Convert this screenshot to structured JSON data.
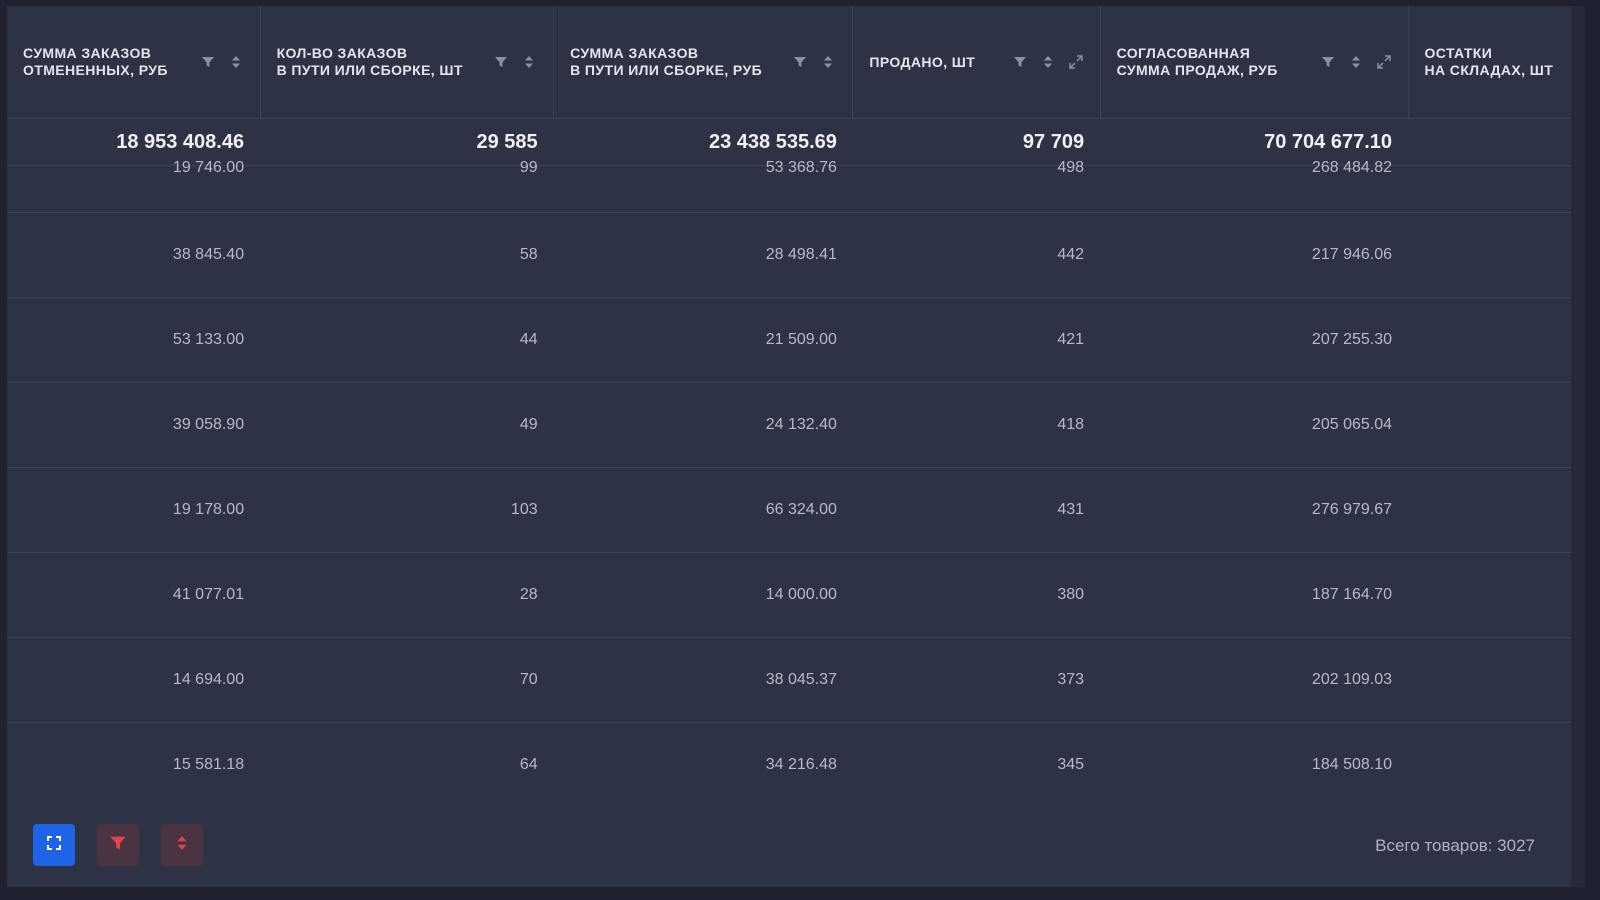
{
  "columns": [
    {
      "label": "СУММА ЗАКАЗОВ\nОТМЕНЕННЫХ, РУБ",
      "expand": false
    },
    {
      "label": "КОЛ-ВО ЗАКАЗОВ\nВ ПУТИ ИЛИ СБОРКЕ, ШТ",
      "expand": false
    },
    {
      "label": "СУММА ЗАКАЗОВ\nВ ПУТИ ИЛИ СБОРКЕ, РУБ",
      "expand": false
    },
    {
      "label": "ПРОДАНО, ШТ",
      "expand": true
    },
    {
      "label": "СОГЛАСОВАННАЯ\nСУММА ПРОДАЖ, РУБ",
      "expand": true
    },
    {
      "label": "ОСТАТКИ\nНА СКЛАДАХ, ШТ",
      "expand": false
    }
  ],
  "totals": [
    "18 953 408.46",
    "29 585",
    "23 438 535.69",
    "97 709",
    "70 704 677.10",
    ""
  ],
  "rows": [
    [
      "19 746.00",
      "99",
      "53 368.76",
      "498",
      "268 484.82",
      ""
    ],
    [
      "38 845.40",
      "58",
      "28 498.41",
      "442",
      "217 946.06",
      ""
    ],
    [
      "53 133.00",
      "44",
      "21 509.00",
      "421",
      "207 255.30",
      ""
    ],
    [
      "39 058.90",
      "49",
      "24 132.40",
      "418",
      "205 065.04",
      ""
    ],
    [
      "19 178.00",
      "103",
      "66 324.00",
      "431",
      "276 979.67",
      ""
    ],
    [
      "41 077.01",
      "28",
      "14 000.00",
      "380",
      "187 164.70",
      ""
    ],
    [
      "14 694.00",
      "70",
      "38 045.37",
      "373",
      "202 109.03",
      ""
    ],
    [
      "15 581.18",
      "64",
      "34 216.48",
      "345",
      "184 508.10",
      ""
    ]
  ],
  "footer": {
    "total_label": "Всего товаров: 3027",
    "buttons": [
      {
        "name": "expand",
        "icon": "fullscreen-icon",
        "color": "#1f63e6"
      },
      {
        "name": "filter",
        "icon": "filter-icon",
        "color": "#e0454f"
      },
      {
        "name": "sort",
        "icon": "sort-icon",
        "color": "#e0454f"
      }
    ]
  },
  "colors": {
    "background": "#2e3245",
    "accent": "#1f63e6",
    "danger": "#e0454f"
  }
}
